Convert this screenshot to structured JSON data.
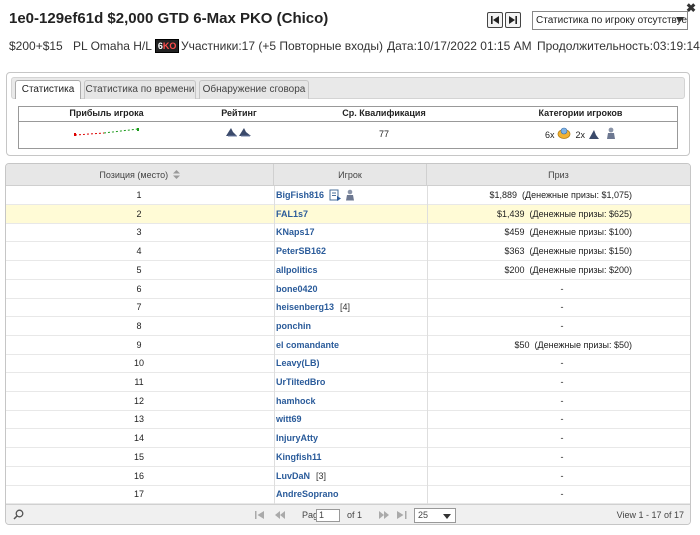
{
  "header": {
    "title": "1e0-129ef61d $2,000 GTD 6-Max PKO (Chico)",
    "player_stats_select": "Статистика по игроку отсутствует",
    "buyin": "$200+$15",
    "game": "PL Omaha H/L",
    "badge_text": "6",
    "badge_hl": "KO",
    "participants": "Участники:17 (+5 Повторные входы)",
    "date": "Дата:10/17/2022 01:15 AM",
    "duration": "Продолжительность:03:19:14"
  },
  "tabs": [
    {
      "label": "Статистика",
      "active": true
    },
    {
      "label": "Статистика по времени",
      "active": false
    },
    {
      "label": "Обнаружение сговора",
      "active": false
    }
  ],
  "stats": {
    "headers": [
      "Прибыль игрока",
      "Рейтинг",
      "Ср. Квалификация",
      "Категории игроков"
    ],
    "avg_qualification": "77",
    "category_counts": [
      "6x",
      "2x"
    ]
  },
  "table": {
    "columns": [
      "Позиция (место)",
      "Игрок",
      "Приз"
    ],
    "rows": [
      {
        "pos": "1",
        "player": "BigFish816",
        "extra": "",
        "prize": "$1,889  (Денежные призы: $1,075)",
        "icons": true
      },
      {
        "pos": "2",
        "player": "FAL1s7",
        "extra": "",
        "prize": "$1,439  (Денежные призы: $625)",
        "highlight": true
      },
      {
        "pos": "3",
        "player": "KNaps17",
        "extra": "",
        "prize": "$459  (Денежные призы: $100)"
      },
      {
        "pos": "4",
        "player": "PeterSB162",
        "extra": "",
        "prize": "$363  (Денежные призы: $150)"
      },
      {
        "pos": "5",
        "player": "allpolitics",
        "extra": "",
        "prize": "$200  (Денежные призы: $200)"
      },
      {
        "pos": "6",
        "player": "bone0420",
        "extra": "",
        "prize": "-"
      },
      {
        "pos": "7",
        "player": "heisenberg13",
        "extra": "[4]",
        "prize": "-"
      },
      {
        "pos": "8",
        "player": "ponchin",
        "extra": "",
        "prize": "-"
      },
      {
        "pos": "9",
        "player": "el comandante",
        "extra": "",
        "prize": "$50  (Денежные призы: $50)"
      },
      {
        "pos": "10",
        "player": "Leavy(LB)",
        "extra": "",
        "prize": "-"
      },
      {
        "pos": "11",
        "player": "UrTiltedBro",
        "extra": "",
        "prize": "-"
      },
      {
        "pos": "12",
        "player": "hamhock",
        "extra": "",
        "prize": "-"
      },
      {
        "pos": "13",
        "player": "witt69",
        "extra": "",
        "prize": "-"
      },
      {
        "pos": "14",
        "player": "InjuryAtty",
        "extra": "",
        "prize": "-"
      },
      {
        "pos": "15",
        "player": "Kingfish11",
        "extra": "",
        "prize": "-"
      },
      {
        "pos": "16",
        "player": "LuvDaN",
        "extra": "[3]",
        "prize": "-"
      },
      {
        "pos": "17",
        "player": "AndreSoprano",
        "extra": "",
        "prize": "-"
      }
    ]
  },
  "pager": {
    "page_label": "Page",
    "page_value": "1",
    "of_label": "of 1",
    "page_size": "25",
    "view_text": "View 1 - 17 of 17"
  }
}
